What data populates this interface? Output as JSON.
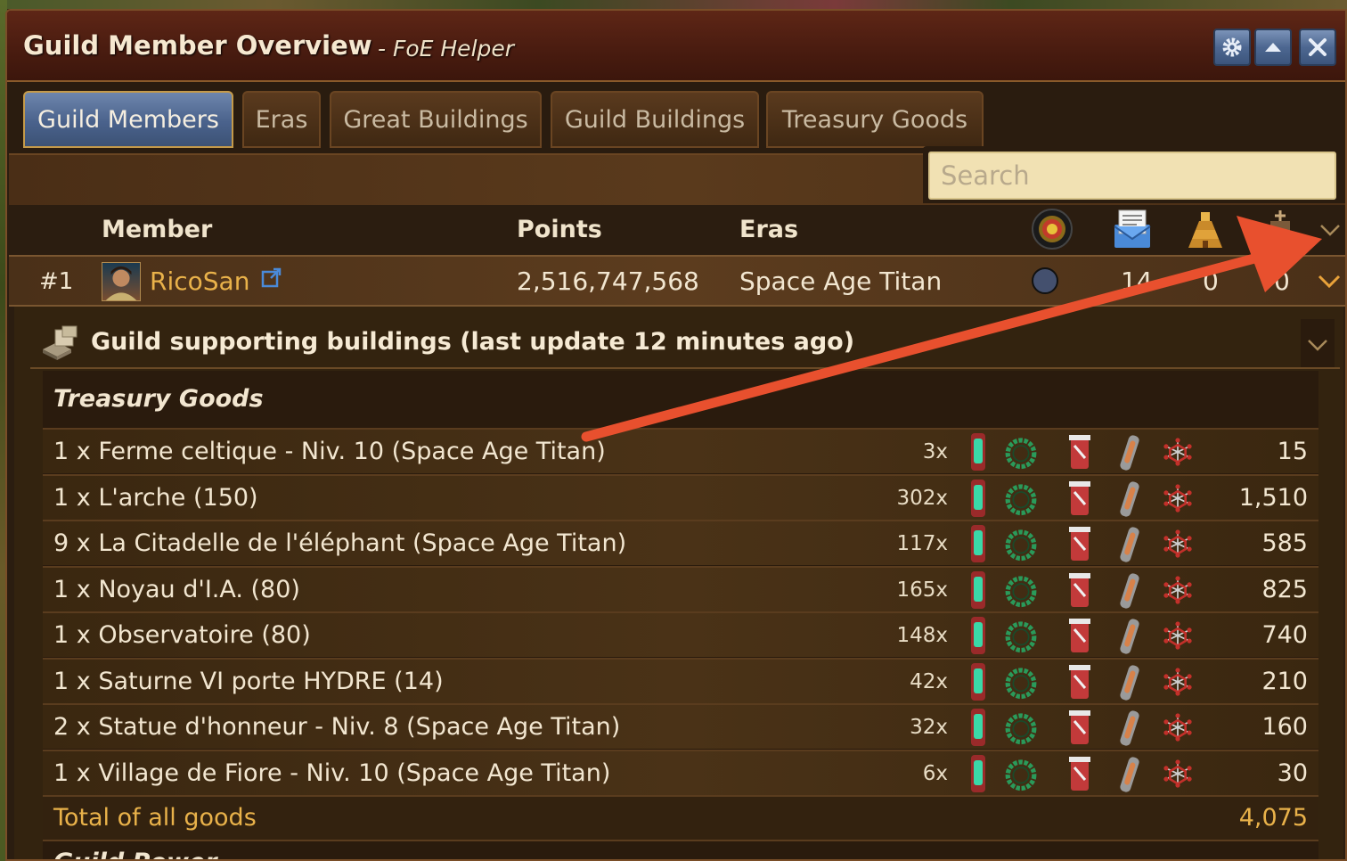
{
  "window": {
    "title": "Guild Member Overview",
    "subtitle": "- FoE Helper"
  },
  "title_buttons": [
    {
      "icon": "gear-icon"
    },
    {
      "icon": "minimize-icon"
    },
    {
      "icon": "close-icon"
    }
  ],
  "tabs": [
    {
      "label": "Guild Members",
      "active": true
    },
    {
      "label": "Eras",
      "active": false
    },
    {
      "label": "Great Buildings",
      "active": false
    },
    {
      "label": "Guild Buildings",
      "active": false
    },
    {
      "label": "Treasury Goods",
      "active": false
    }
  ],
  "search": {
    "placeholder": "Search",
    "value": ""
  },
  "table_header": {
    "member": "Member",
    "points": "Points",
    "eras": "Eras",
    "icons": [
      "target-icon",
      "message-icon",
      "great-building-icon",
      "guild-building-icon"
    ]
  },
  "member": {
    "rank": "#1",
    "name": "RicoSan",
    "points": "2,516,747,568",
    "era": "Space Age Titan",
    "stat_messages": "14",
    "stat_buildings": "0",
    "stat_guild": "0"
  },
  "support": {
    "title": "Guild supporting buildings (last update 12 minutes ago)",
    "section_title": "Treasury Goods",
    "rows": [
      {
        "name": "1 x Ferme celtique - Niv. 10 (Space Age Titan)",
        "count": "3x",
        "total": "15"
      },
      {
        "name": "1 x L'arche (150)",
        "count": "302x",
        "total": "1,510"
      },
      {
        "name": "9 x La Citadelle de l'éléphant (Space Age Titan)",
        "count": "117x",
        "total": "585"
      },
      {
        "name": "1 x Noyau d'I.A. (80)",
        "count": "165x",
        "total": "825"
      },
      {
        "name": "1 x Observatoire (80)",
        "count": "148x",
        "total": "740"
      },
      {
        "name": "1 x Saturne VI porte HYDRE (14)",
        "count": "42x",
        "total": "210"
      },
      {
        "name": "2 x Statue d'honneur - Niv. 8 (Space Age Titan)",
        "count": "32x",
        "total": "160"
      },
      {
        "name": "1 x Village de Fiore - Niv. 10 (Space Age Titan)",
        "count": "6x",
        "total": "30"
      }
    ],
    "total_label": "Total of all goods",
    "total_value": "4,075",
    "next_section": "Guild Power"
  },
  "colors": {
    "accent_gold": "#e9b24a",
    "annotation_arrow": "#e8502e",
    "active_tab": "#4a628c"
  }
}
